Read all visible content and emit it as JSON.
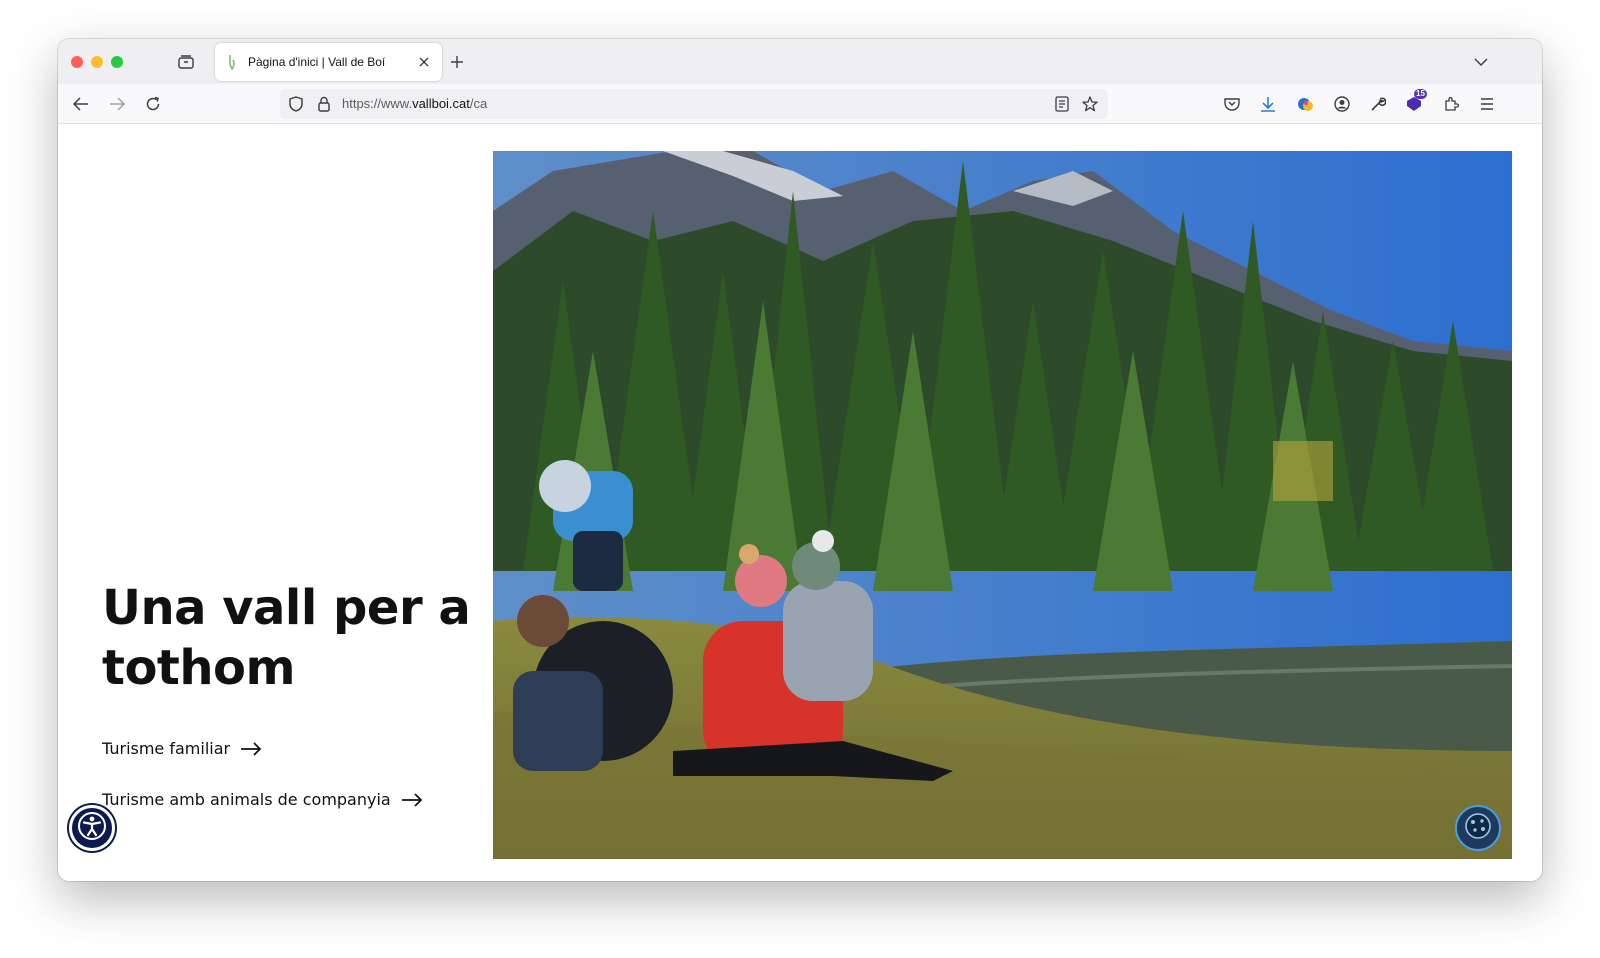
{
  "browser": {
    "tab": {
      "title": "Pàgina d'inici | Vall de Boí"
    },
    "url": {
      "prefix": "https://www.",
      "domain": "vallboi.cat",
      "path": "/ca"
    },
    "extension_badge": "15"
  },
  "page": {
    "headline": "Una vall per a tothom",
    "links": [
      {
        "label": "Turisme familiar"
      },
      {
        "label": "Turisme amb animals de companyia"
      }
    ],
    "hero_image": "family-in-mountain-forest-by-river",
    "accessibility_button": "accessibility-icon",
    "cookie_button": "cookie-icon"
  },
  "colors": {
    "accessibility_bg": "#0d1a52",
    "cookie_bg": "#1e3a5c",
    "cookie_border": "#4a9de0",
    "extension_badge_bg": "#5b2fc4"
  }
}
